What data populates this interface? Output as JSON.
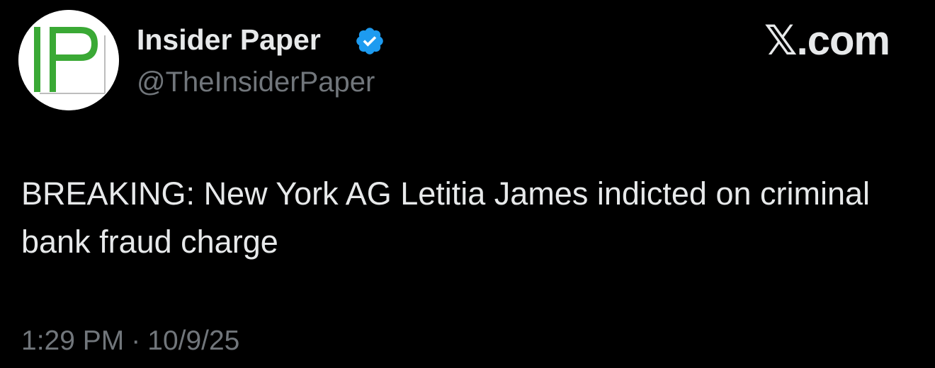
{
  "author": {
    "display_name": "Insider Paper",
    "handle": "@TheInsiderPaper",
    "verified": true,
    "avatar_text": "IP"
  },
  "brand": {
    "label": "𝕏.com"
  },
  "tweet": {
    "text": "BREAKING: New York AG Letitia James indicted on criminal bank fraud charge",
    "time": "1:29 PM",
    "separator": "·",
    "date": "10/9/25"
  },
  "colors": {
    "background": "#000000",
    "primary_text": "#e7e9ea",
    "secondary_text": "#71767b",
    "verified_blue": "#1d9bf0",
    "logo_green": "#3aa935"
  }
}
